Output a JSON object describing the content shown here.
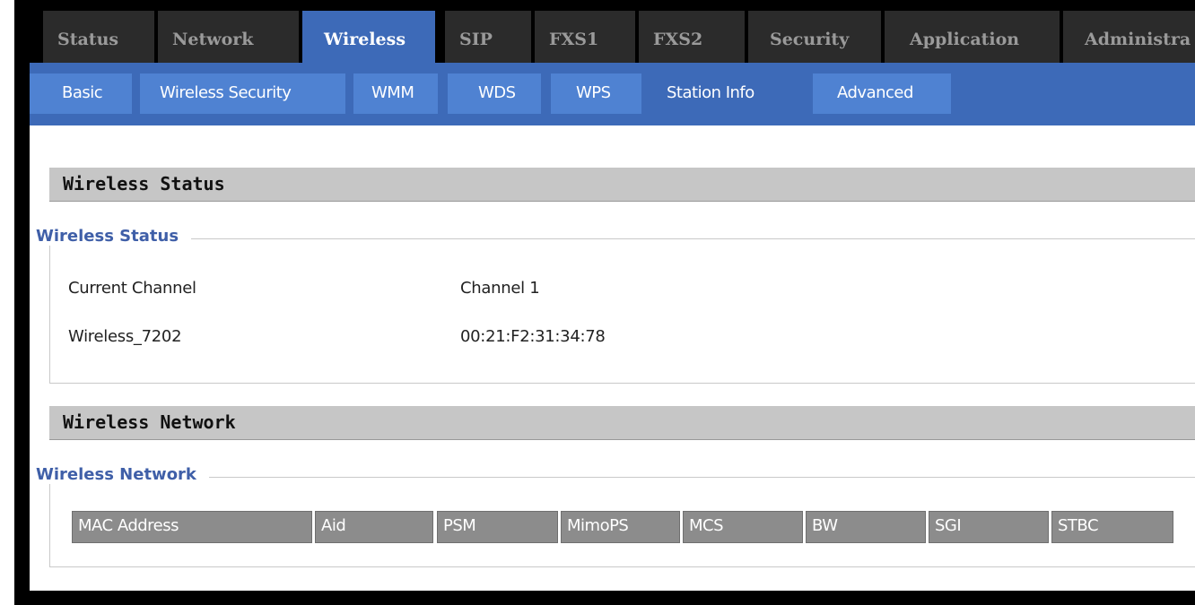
{
  "top_tabs": [
    "Status",
    "Network",
    "Wireless",
    "SIP",
    "FXS1",
    "FXS2",
    "Security",
    "Application",
    "Administra"
  ],
  "active_top_tab": "Wireless",
  "sub_tabs": [
    "Basic",
    "Wireless Security",
    "WMM",
    "WDS",
    "WPS",
    "Station Info",
    "Advanced"
  ],
  "active_sub_tab": "Station Info",
  "wireless_status": {
    "header": "Wireless Status",
    "legend": "Wireless Status",
    "rows": [
      {
        "label": "Current Channel",
        "value": "Channel 1"
      },
      {
        "label": "Wireless_7202",
        "value": "00:21:F2:31:34:78"
      }
    ]
  },
  "wireless_network": {
    "header": "Wireless Network",
    "legend": "Wireless Network",
    "columns": [
      "MAC Address",
      "Aid",
      "PSM",
      "MimoPS",
      "MCS",
      "BW",
      "SGI",
      "STBC"
    ]
  },
  "colors": {
    "tab_bar_bg": "#000000",
    "tab_inactive": "#2b2b2b",
    "tab_active": "#3d6ab8",
    "sub_tab": "#4f82d2",
    "legend_text": "#3f5fa8",
    "column_header": "#8c8c8c"
  }
}
